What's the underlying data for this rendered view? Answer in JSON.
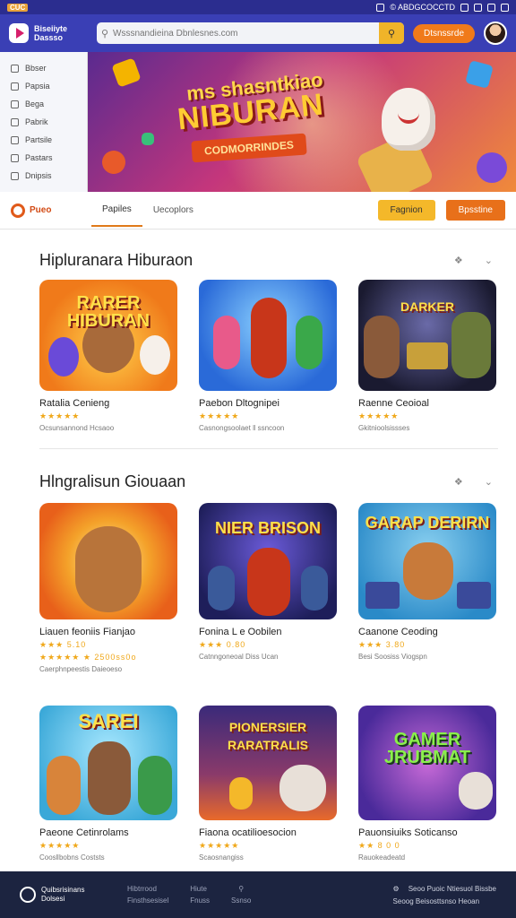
{
  "status": {
    "badge": "CUC",
    "right_text": "© ABDGCOCCTD"
  },
  "header": {
    "logo_line1": "Biseiiyte",
    "logo_line2": "Dassso",
    "search_placeholder": "Wsssnandieina Dbnlesnes.com",
    "signup_label": "Dtsnssrde"
  },
  "sidebar": {
    "items": [
      {
        "label": "Bbser",
        "icon": "controller-icon"
      },
      {
        "label": "Papsia",
        "icon": "tag-icon"
      },
      {
        "label": "Bega",
        "icon": "gift-icon"
      },
      {
        "label": "Pabrik",
        "icon": "trophy-icon"
      },
      {
        "label": "Partsile",
        "icon": "user-icon"
      },
      {
        "label": "Pastars",
        "icon": "heart-icon"
      },
      {
        "label": "Dnipsis",
        "icon": "grid-icon"
      }
    ]
  },
  "banner": {
    "title_line1": "ms shasntkiao",
    "title_line2": "NIBURAN",
    "ribbon": "CODMORRINDES"
  },
  "tabbar": {
    "logo": "Pueo",
    "tabs": [
      "Papiles",
      "Uecoplors"
    ],
    "btn_yellow": "Fagnion",
    "btn_orange": "Bpsstine"
  },
  "sections": [
    {
      "title": "Hipluranara Hiburaon",
      "cards": [
        {
          "name": "Ratalia Cenieng",
          "rating": "★★★★★",
          "meta": "Ocsunsannond Hcsaoo",
          "art": "RARER HIBURAN",
          "bg": "#f08a2a"
        },
        {
          "name": "Paebon Dltognipei",
          "rating": "★★★★★",
          "meta": "Casnongsoolaet ‖ ssncoon",
          "art": "",
          "bg": "#3a7ad8"
        },
        {
          "name": "Raenne Ceoioal",
          "rating": "★★★★★",
          "meta": "Gkitnioolsissses",
          "art": "DARKER",
          "bg": "#2a2a48"
        }
      ]
    },
    {
      "title": "Hlngralisun Giouaan",
      "cards": [
        {
          "name": "Liauen feoniis Fianjao",
          "rating": "★★★ 5.10",
          "rating2": "★★★★★ ★ 2500ss0o",
          "meta": "Caerphnpeestis Daieoeso",
          "art": "",
          "bg": "#f4a22a"
        },
        {
          "name": "Fonina L e Oobilen",
          "rating": "★★★ 0.80",
          "meta": "Catnngoneoal Diss Ucan",
          "art": "NIER BRISON",
          "bg": "#3a3a8a"
        },
        {
          "name": "Caanone Ceoding",
          "rating": "★★★ 3.80",
          "meta": "Besi Soosiss Viogspn",
          "art": "GARAP DERIRN",
          "bg": "#2a9ac8"
        }
      ]
    },
    {
      "title": "",
      "cards": [
        {
          "name": "Paeone Cetinrolams",
          "rating": "★★★★★",
          "meta": "Coos‖bobns Coststs",
          "art": "SAREI",
          "bg": "#3aa8d8"
        },
        {
          "name": "Fiaona ocatilioesocion",
          "rating": "★★★★★",
          "meta": "Scaosnangiss",
          "art": "PIONERSIER RARATRALIS",
          "bg": "#5a3a9a"
        },
        {
          "name": "Pauonsiuiks Soticanso",
          "rating": "★★ 8 0 0",
          "meta": "Rauokeadeatd",
          "art": "GAMER JRUBMAT",
          "bg": "#7a3ac8"
        }
      ]
    }
  ],
  "bottomnav": {
    "logo_line1": "Quibsrisinans",
    "logo_line2": "Dolsesi",
    "col1": [
      "Hibtrrood",
      "Finsthsesisel"
    ],
    "col2": [
      "Hiute",
      "Fnuss"
    ],
    "search_label": "Ssnso",
    "right_line1": "Seoo Puoic Ntiesuol Bissbe",
    "right_line2": "Seoog  Beisosttsnso Heoan"
  }
}
